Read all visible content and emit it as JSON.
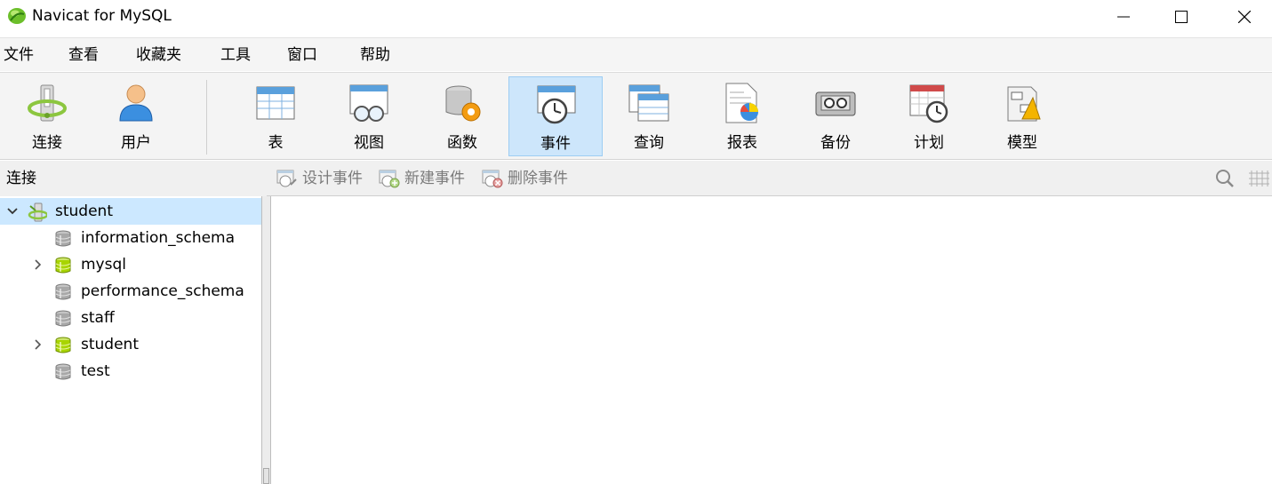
{
  "window": {
    "title": "Navicat for MySQL"
  },
  "menu": {
    "items": [
      "文件",
      "查看",
      "收藏夹",
      "工具",
      "窗口",
      "帮助"
    ]
  },
  "toolbar": {
    "items": [
      {
        "label": "连接",
        "icon": "connection-icon"
      },
      {
        "label": "用户",
        "icon": "user-icon"
      },
      {
        "label": "表",
        "icon": "table-icon"
      },
      {
        "label": "视图",
        "icon": "view-icon"
      },
      {
        "label": "函数",
        "icon": "function-icon"
      },
      {
        "label": "事件",
        "icon": "event-icon",
        "active": true
      },
      {
        "label": "查询",
        "icon": "query-icon"
      },
      {
        "label": "报表",
        "icon": "report-icon"
      },
      {
        "label": "备份",
        "icon": "backup-icon"
      },
      {
        "label": "计划",
        "icon": "schedule-icon"
      },
      {
        "label": "模型",
        "icon": "model-icon"
      }
    ]
  },
  "left_panel": {
    "header": "连接"
  },
  "object_toolbar": {
    "design_label": "设计事件",
    "new_label": "新建事件",
    "delete_label": "删除事件"
  },
  "tree": {
    "connection": {
      "name": "student",
      "expanded": true
    },
    "databases": [
      {
        "name": "information_schema",
        "active": false,
        "expandable": false
      },
      {
        "name": "mysql",
        "active": true,
        "expandable": true
      },
      {
        "name": "performance_schema",
        "active": false,
        "expandable": false
      },
      {
        "name": "staff",
        "active": false,
        "expandable": false
      },
      {
        "name": "student",
        "active": true,
        "expandable": true
      },
      {
        "name": "test",
        "active": false,
        "expandable": false
      }
    ]
  },
  "colors": {
    "active_tool_bg": "#cde6fb",
    "selected_row_bg": "#cce8ff",
    "disabled_text": "#7a7a7a",
    "db_active": "#a8d400",
    "db_inactive": "#9a9a9a"
  }
}
